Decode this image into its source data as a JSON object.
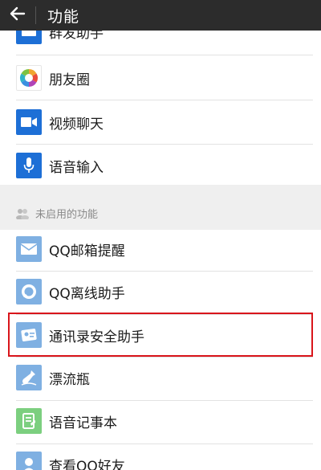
{
  "header": {
    "title": "功能",
    "back_icon": "arrow-left-icon"
  },
  "enabled_items": [
    {
      "label": "群发助手",
      "icon": "broadcast-icon",
      "color": "#1d6fd6"
    },
    {
      "label": "朋友圈",
      "icon": "moments-icon",
      "color": "#ffffff"
    },
    {
      "label": "视频聊天",
      "icon": "video-camera-icon",
      "color": "#1d6fd6"
    },
    {
      "label": "语音输入",
      "icon": "microphone-icon",
      "color": "#1d6fd6"
    }
  ],
  "disabled_section": {
    "label": "未启用的功能",
    "icon": "people-icon"
  },
  "disabled_items": [
    {
      "label": "QQ邮箱提醒",
      "icon": "mail-icon",
      "color": "#7fb0e2"
    },
    {
      "label": "QQ离线助手",
      "icon": "qq-offline-icon",
      "color": "#7fb0e2"
    },
    {
      "label": "通讯录安全助手",
      "icon": "contacts-security-icon",
      "color": "#7fb0e2"
    },
    {
      "label": "漂流瓶",
      "icon": "bottle-icon",
      "color": "#7fb0e2"
    },
    {
      "label": "语音记事本",
      "icon": "voice-notepad-icon",
      "color": "#7ccf7f"
    },
    {
      "label": "查看QQ好友",
      "icon": "qq-friends-icon",
      "color": "#7fb0e2"
    }
  ],
  "highlight_color": "#d9151b"
}
